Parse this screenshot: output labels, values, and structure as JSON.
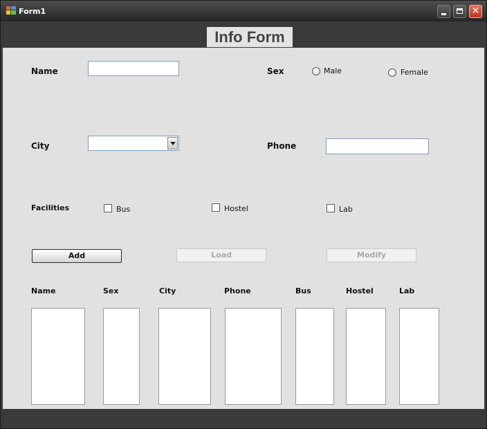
{
  "window": {
    "title": "Form1"
  },
  "header": {
    "title": "Info Form"
  },
  "form": {
    "name_label": "Name",
    "sex_label": "Sex",
    "male_label": "Male",
    "female_label": "Female",
    "city_label": "City",
    "phone_label": "Phone",
    "facilities_label": "Facilities",
    "bus_label": "Bus",
    "hostel_label": "Hostel",
    "lab_label": "Lab",
    "name_value": "",
    "city_value": "",
    "phone_value": ""
  },
  "buttons": {
    "add_label": "Add",
    "load_label": "Load",
    "modify_label": "Modify"
  },
  "columns": {
    "name": "Name",
    "sex": "Sex",
    "city": "City",
    "phone": "Phone",
    "bus": "Bus",
    "hostel": "Hostel",
    "lab": "Lab"
  },
  "icons": {
    "app": "app-icon",
    "minimize": "minimize-icon",
    "maximize": "maximize-icon",
    "close": "close-icon",
    "dropdown": "chevron-down-icon"
  },
  "colors": {
    "titlebar": "#3a3a3a",
    "client": "#e1e1e1",
    "close_button": "#c0301c"
  }
}
